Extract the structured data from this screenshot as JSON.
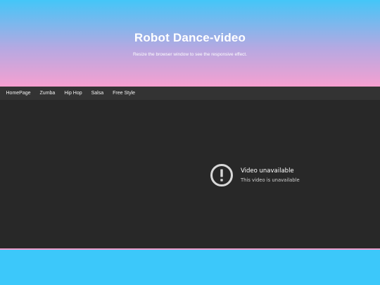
{
  "header": {
    "title": "Robot Dance-video",
    "subtitle": "Resize the browser window to see the responsive effect."
  },
  "navbar": {
    "items": [
      {
        "label": "HomePage"
      },
      {
        "label": "Zumba"
      },
      {
        "label": "Hip Hop"
      },
      {
        "label": "Salsa"
      },
      {
        "label": "Free Style"
      }
    ]
  },
  "video": {
    "icon": "alert-circle-icon",
    "title": "Video unavailable",
    "message": "This video is unavailable"
  },
  "colors": {
    "header_top": "#44c6f8",
    "header_bottom": "#f6a0d0",
    "navbar_bg": "#333333",
    "video_bg": "#282828",
    "page_bg": "#3cc8fa"
  }
}
